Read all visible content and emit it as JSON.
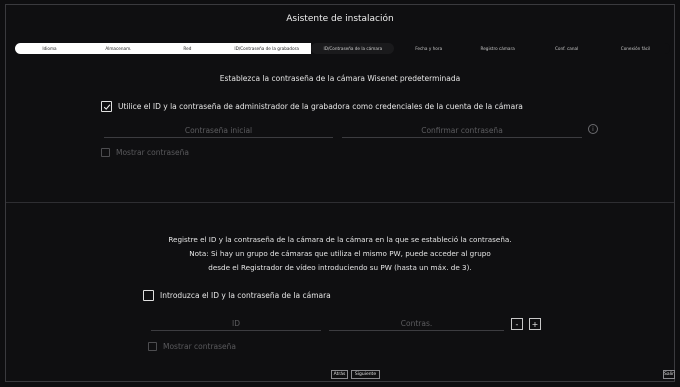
{
  "window": {
    "title": "Asistente de instalación"
  },
  "steps": [
    {
      "label": "Idioma"
    },
    {
      "label": "Almacenam."
    },
    {
      "label": "Red"
    },
    {
      "label": "ID/Contraseña de la grabadora"
    },
    {
      "label": "ID/Contraseña de la cámara"
    },
    {
      "label": "Fecha y hora"
    },
    {
      "label": "Registro cámara"
    },
    {
      "label": "Conf. canal"
    },
    {
      "label": "Conexión fácil"
    }
  ],
  "section1": {
    "heading": "Establezca la contraseña de la cámara Wisenet predeterminada",
    "use_admin_label": "Utilice el ID y la contraseña de administrador de la grabadora como credenciales de la cuenta de la cámara",
    "initial_password_placeholder": "Contraseña inicial",
    "confirm_password_placeholder": "Confirmar contraseña",
    "info_glyph": "i",
    "show_password_label": "Mostrar contraseña"
  },
  "section2": {
    "line1": "Registre el ID y la contraseña de la cámara de la cámara en la que se estableció la contraseña.",
    "line2": "Nota: Si hay un grupo de cámaras que utiliza el mismo PW, puede acceder al grupo",
    "line3": "desde el Registrador de vídeo introduciendo su PW (hasta un máx. de 3).",
    "enter_id_label": "Introduzca el ID y la contraseña de la cámara",
    "id_placeholder": "ID",
    "password_placeholder": "Contras.",
    "minus_label": "-",
    "plus_label": "+",
    "show_password_label": "Mostrar contraseña"
  },
  "footer": {
    "back_label": "Atrás",
    "next_label": "Siguiente",
    "exit_label": "Salir"
  }
}
